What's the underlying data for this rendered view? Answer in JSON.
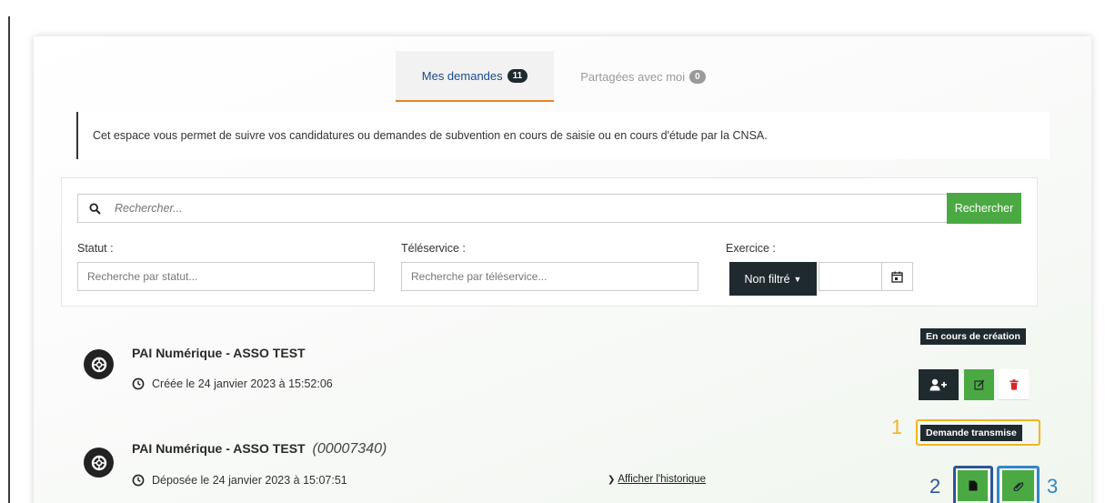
{
  "tabs": {
    "mine": {
      "label": "Mes demandes",
      "count": "11"
    },
    "shared": {
      "label": "Partagées avec moi",
      "count": "0"
    }
  },
  "info_text": "Cet espace vous permet de suivre vos candidatures ou demandes de subvention en cours de saisie ou en cours d'étude par la CNSA.",
  "search": {
    "placeholder": "Rechercher...",
    "button": "Rechercher"
  },
  "filters": {
    "statut": {
      "label": "Statut :",
      "placeholder": "Recherche par statut..."
    },
    "teleservice": {
      "label": "Téléservice :",
      "placeholder": "Recherche par téléservice..."
    },
    "exercice": {
      "label": "Exercice :",
      "dropdown": "Non filtré",
      "year": ""
    }
  },
  "demandes": [
    {
      "title": "PAI Numérique - ASSO TEST",
      "number": "",
      "date": "Créée le 24 janvier 2023 à 15:52:06",
      "status": "En cours de création",
      "actions": [
        "user-plus-icon",
        "edit-icon",
        "trash-icon"
      ]
    },
    {
      "title": "PAI Numérique - ASSO TEST",
      "number": "(00007340)",
      "date": "Déposée le 24 janvier 2023 à 15:07:51",
      "status": "Demande transmise",
      "history_link": "Afficher l'historique",
      "actions": [
        "document-icon",
        "attachment-icon"
      ]
    }
  ],
  "annotations": {
    "one": "1",
    "two": "2",
    "three": "3"
  },
  "colors": {
    "dark": "#1f2a2e",
    "green": "#4ba943",
    "tab_accent": "#e8832a",
    "tab_text": "#1a4a8a",
    "highlight_yellow": "#f0b61e",
    "highlight_navy": "#2f5597",
    "highlight_blue": "#2e88c9"
  }
}
